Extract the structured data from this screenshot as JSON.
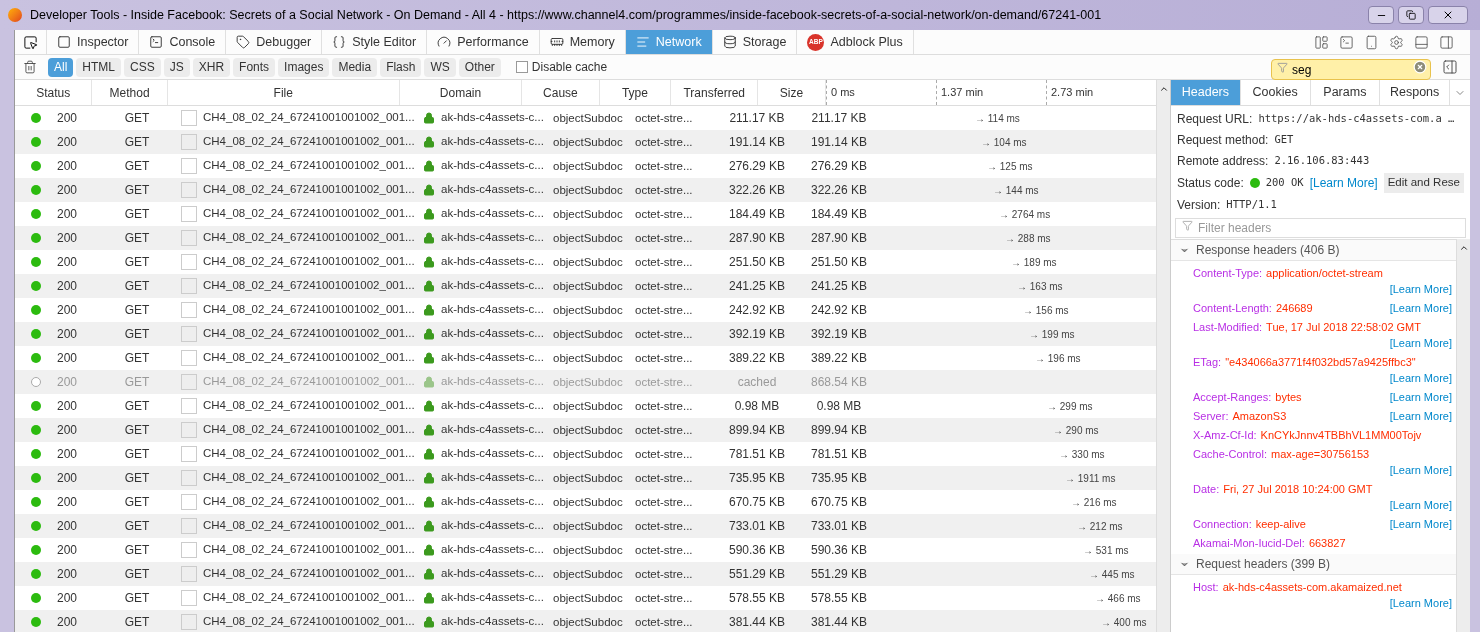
{
  "window": {
    "title": "Developer Tools - Inside Facebook: Secrets of a Social Network - On Demand - All 4 - https://www.channel4.com/programmes/inside-facebook-secrets-of-a-social-network/on-demand/67241-001"
  },
  "tools": [
    {
      "label": "Inspector",
      "kind": "inspector",
      "selected": false
    },
    {
      "label": "Console",
      "kind": "console",
      "selected": false
    },
    {
      "label": "Debugger",
      "kind": "debugger",
      "selected": false
    },
    {
      "label": "Style Editor",
      "kind": "style",
      "selected": false
    },
    {
      "label": "Performance",
      "kind": "performance",
      "selected": false
    },
    {
      "label": "Memory",
      "kind": "memory",
      "selected": false
    },
    {
      "label": "Network",
      "kind": "network",
      "selected": true
    },
    {
      "label": "Storage",
      "kind": "storage",
      "selected": false
    },
    {
      "label": "Adblock Plus",
      "kind": "abp",
      "badge": "ABP",
      "selected": false
    }
  ],
  "filters": [
    {
      "label": "All",
      "selected": true
    },
    {
      "label": "HTML",
      "selected": false
    },
    {
      "label": "CSS",
      "selected": false
    },
    {
      "label": "JS",
      "selected": false
    },
    {
      "label": "XHR",
      "selected": false
    },
    {
      "label": "Fonts",
      "selected": false
    },
    {
      "label": "Images",
      "selected": false
    },
    {
      "label": "Media",
      "selected": false
    },
    {
      "label": "Flash",
      "selected": false
    },
    {
      "label": "WS",
      "selected": false
    },
    {
      "label": "Other",
      "selected": false
    }
  ],
  "disable_cache": {
    "label": "Disable cache",
    "checked": false
  },
  "url_filter": {
    "value": "seg"
  },
  "table": {
    "columns": [
      "Status",
      "Method",
      "File",
      "Domain",
      "Cause",
      "Type",
      "Transferred",
      "Size"
    ],
    "waterfall_ticks": [
      "0 ms",
      "1.37 min",
      "2.73 min"
    ],
    "rows": [
      {
        "status": "200",
        "method": "GET",
        "file": "CH4_08_02_24_67241001001002_001...",
        "domain": "ak-hds-c4assets-c...",
        "cause": "objectSubdoc",
        "type": "octet-stre...",
        "transferred": "211.17 KB",
        "size": "211.17 KB",
        "timing": "→ 114 ms",
        "cached": false
      },
      {
        "status": "200",
        "method": "GET",
        "file": "CH4_08_02_24_67241001001002_001...",
        "domain": "ak-hds-c4assets-c...",
        "cause": "objectSubdoc",
        "type": "octet-stre...",
        "transferred": "191.14 KB",
        "size": "191.14 KB",
        "timing": "→ 104 ms",
        "cached": false
      },
      {
        "status": "200",
        "method": "GET",
        "file": "CH4_08_02_24_67241001001002_001...",
        "domain": "ak-hds-c4assets-c...",
        "cause": "objectSubdoc",
        "type": "octet-stre...",
        "transferred": "276.29 KB",
        "size": "276.29 KB",
        "timing": "→ 125 ms",
        "cached": false
      },
      {
        "status": "200",
        "method": "GET",
        "file": "CH4_08_02_24_67241001001002_001...",
        "domain": "ak-hds-c4assets-c...",
        "cause": "objectSubdoc",
        "type": "octet-stre...",
        "transferred": "322.26 KB",
        "size": "322.26 KB",
        "timing": "→ 144 ms",
        "cached": false
      },
      {
        "status": "200",
        "method": "GET",
        "file": "CH4_08_02_24_67241001001002_001...",
        "domain": "ak-hds-c4assets-c...",
        "cause": "objectSubdoc",
        "type": "octet-stre...",
        "transferred": "184.49 KB",
        "size": "184.49 KB",
        "timing": "→ 2764 ms",
        "cached": false
      },
      {
        "status": "200",
        "method": "GET",
        "file": "CH4_08_02_24_67241001001002_001...",
        "domain": "ak-hds-c4assets-c...",
        "cause": "objectSubdoc",
        "type": "octet-stre...",
        "transferred": "287.90 KB",
        "size": "287.90 KB",
        "timing": "→ 288 ms",
        "cached": false
      },
      {
        "status": "200",
        "method": "GET",
        "file": "CH4_08_02_24_67241001001002_001...",
        "domain": "ak-hds-c4assets-c...",
        "cause": "objectSubdoc",
        "type": "octet-stre...",
        "transferred": "251.50 KB",
        "size": "251.50 KB",
        "timing": "→ 189 ms",
        "cached": false
      },
      {
        "status": "200",
        "method": "GET",
        "file": "CH4_08_02_24_67241001001002_001...",
        "domain": "ak-hds-c4assets-c...",
        "cause": "objectSubdoc",
        "type": "octet-stre...",
        "transferred": "241.25 KB",
        "size": "241.25 KB",
        "timing": "→ 163 ms",
        "cached": false
      },
      {
        "status": "200",
        "method": "GET",
        "file": "CH4_08_02_24_67241001001002_001...",
        "domain": "ak-hds-c4assets-c...",
        "cause": "objectSubdoc",
        "type": "octet-stre...",
        "transferred": "242.92 KB",
        "size": "242.92 KB",
        "timing": "→ 156 ms",
        "cached": false
      },
      {
        "status": "200",
        "method": "GET",
        "file": "CH4_08_02_24_67241001001002_001...",
        "domain": "ak-hds-c4assets-c...",
        "cause": "objectSubdoc",
        "type": "octet-stre...",
        "transferred": "392.19 KB",
        "size": "392.19 KB",
        "timing": "→ 199 ms",
        "cached": false
      },
      {
        "status": "200",
        "method": "GET",
        "file": "CH4_08_02_24_67241001001002_001...",
        "domain": "ak-hds-c4assets-c...",
        "cause": "objectSubdoc",
        "type": "octet-stre...",
        "transferred": "389.22 KB",
        "size": "389.22 KB",
        "timing": "→ 196 ms",
        "cached": false
      },
      {
        "status": "200",
        "method": "GET",
        "file": "CH4_08_02_24_67241001001002_001...",
        "domain": "ak-hds-c4assets-c...",
        "cause": "objectSubdoc",
        "type": "octet-stre...",
        "transferred": "cached",
        "size": "868.54 KB",
        "cached": true
      },
      {
        "status": "200",
        "method": "GET",
        "file": "CH4_08_02_24_67241001001002_001...",
        "domain": "ak-hds-c4assets-c...",
        "cause": "objectSubdoc",
        "type": "octet-stre...",
        "transferred": "0.98 MB",
        "size": "0.98 MB",
        "timing": "→ 299 ms",
        "cached": false
      },
      {
        "status": "200",
        "method": "GET",
        "file": "CH4_08_02_24_67241001001002_001...",
        "domain": "ak-hds-c4assets-c...",
        "cause": "objectSubdoc",
        "type": "octet-stre...",
        "transferred": "899.94 KB",
        "size": "899.94 KB",
        "timing": "→ 290 ms",
        "cached": false
      },
      {
        "status": "200",
        "method": "GET",
        "file": "CH4_08_02_24_67241001001002_001...",
        "domain": "ak-hds-c4assets-c...",
        "cause": "objectSubdoc",
        "type": "octet-stre...",
        "transferred": "781.51 KB",
        "size": "781.51 KB",
        "timing": "→ 330 ms",
        "cached": false
      },
      {
        "status": "200",
        "method": "GET",
        "file": "CH4_08_02_24_67241001001002_001...",
        "domain": "ak-hds-c4assets-c...",
        "cause": "objectSubdoc",
        "type": "octet-stre...",
        "transferred": "735.95 KB",
        "size": "735.95 KB",
        "timing": "→ 1911 ms",
        "cached": false
      },
      {
        "status": "200",
        "method": "GET",
        "file": "CH4_08_02_24_67241001001002_001...",
        "domain": "ak-hds-c4assets-c...",
        "cause": "objectSubdoc",
        "type": "octet-stre...",
        "transferred": "670.75 KB",
        "size": "670.75 KB",
        "timing": "→ 216 ms",
        "cached": false
      },
      {
        "status": "200",
        "method": "GET",
        "file": "CH4_08_02_24_67241001001002_001...",
        "domain": "ak-hds-c4assets-c...",
        "cause": "objectSubdoc",
        "type": "octet-stre...",
        "transferred": "733.01 KB",
        "size": "733.01 KB",
        "timing": "→ 212 ms",
        "cached": false
      },
      {
        "status": "200",
        "method": "GET",
        "file": "CH4_08_02_24_67241001001002_001...",
        "domain": "ak-hds-c4assets-c...",
        "cause": "objectSubdoc",
        "type": "octet-stre...",
        "transferred": "590.36 KB",
        "size": "590.36 KB",
        "timing": "→ 531 ms",
        "cached": false
      },
      {
        "status": "200",
        "method": "GET",
        "file": "CH4_08_02_24_67241001001002_001...",
        "domain": "ak-hds-c4assets-c...",
        "cause": "objectSubdoc",
        "type": "octet-stre...",
        "transferred": "551.29 KB",
        "size": "551.29 KB",
        "timing": "→ 445 ms",
        "cached": false
      },
      {
        "status": "200",
        "method": "GET",
        "file": "CH4_08_02_24_67241001001002_001...",
        "domain": "ak-hds-c4assets-c...",
        "cause": "objectSubdoc",
        "type": "octet-stre...",
        "transferred": "578.55 KB",
        "size": "578.55 KB",
        "timing": "→ 466 ms",
        "cached": false
      },
      {
        "status": "200",
        "method": "GET",
        "file": "CH4_08_02_24_67241001001002_001...",
        "domain": "ak-hds-c4assets-c...",
        "cause": "objectSubdoc",
        "type": "octet-stre...",
        "transferred": "381.44 KB",
        "size": "381.44 KB",
        "timing": "→ 400 ms",
        "cached": false
      }
    ]
  },
  "details": {
    "tabs": [
      {
        "label": "Headers",
        "selected": true
      },
      {
        "label": "Cookies",
        "selected": false
      },
      {
        "label": "Params",
        "selected": false
      },
      {
        "label": "Respons",
        "selected": false
      }
    ],
    "summary": [
      {
        "label": "Request URL:",
        "value": "https://ak-hds-c4assets-com.a …"
      },
      {
        "label": "Request method:",
        "value": "GET"
      },
      {
        "label": "Remote address:",
        "value": "2.16.106.83:443"
      }
    ],
    "status": {
      "label": "Status code:",
      "value": "200 OK",
      "learn_more": "[Learn More]",
      "button": "Edit and Rese"
    },
    "version": {
      "label": "Version:",
      "value": "HTTP/1.1"
    },
    "filter": {
      "placeholder": "Filter headers"
    },
    "sections": [
      {
        "title": "Response headers (406 B)",
        "expanded": true,
        "headers": [
          {
            "name": "Content-Type:",
            "value": "application/octet-stream",
            "learn_more": "[Learn More]"
          },
          {
            "name": "Content-Length:",
            "value": "246689",
            "learn_more": "[Learn More]"
          },
          {
            "name": "Last-Modified:",
            "value": "Tue, 17 Jul 2018 22:58:02 GMT",
            "learn_more": "[Learn More]"
          },
          {
            "name": "ETag:",
            "value": "\"e434066a3771f4f032bd57a9425ffbc3\"",
            "learn_more": "[Learn More]"
          },
          {
            "name": "Accept-Ranges:",
            "value": "bytes",
            "learn_more": "[Learn More]"
          },
          {
            "name": "Server:",
            "value": "AmazonS3",
            "learn_more": "[Learn More]"
          },
          {
            "name": "X-Amz-Cf-Id:",
            "value": "KnCYkJnnv4TBBhVL1MM00Tojv"
          },
          {
            "name": "Cache-Control:",
            "value": "max-age=30756153",
            "learn_more": "[Learn More]"
          },
          {
            "name": "Date:",
            "value": "Fri, 27 Jul 2018 10:24:00 GMT",
            "learn_more": "[Learn More]"
          },
          {
            "name": "Connection:",
            "value": "keep-alive",
            "learn_more": "[Learn More]"
          },
          {
            "name": "Akamai-Mon-Iucid-Del:",
            "value": "663827"
          }
        ]
      },
      {
        "title": "Request headers (399 B)",
        "expanded": true,
        "headers": [
          {
            "name": "Host:",
            "value": "ak-hds-c4assets-com.akamaized.net",
            "learn_more": "[Learn More]"
          }
        ]
      }
    ]
  }
}
